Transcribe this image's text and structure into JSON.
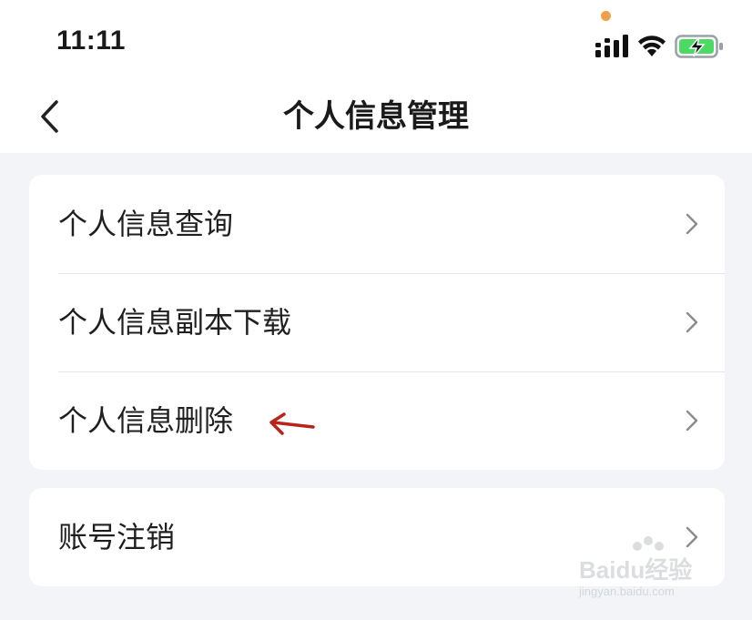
{
  "status_bar": {
    "time": "11:11"
  },
  "nav": {
    "title": "个人信息管理"
  },
  "groups": [
    {
      "items": [
        {
          "label": "个人信息查询"
        },
        {
          "label": "个人信息副本下载"
        },
        {
          "label": "个人信息删除"
        }
      ]
    },
    {
      "items": [
        {
          "label": "账号注销"
        }
      ]
    }
  ],
  "watermark": {
    "brand": "Baidu经验",
    "url": "jingyan.baidu.com"
  },
  "colors": {
    "annotation_arrow": "#b8241c",
    "battery_fill": "#4cd964",
    "recording_dot": "#f0a04b"
  },
  "icons": {
    "back": "chevron-left-icon",
    "row_action": "chevron-right-icon",
    "annotation": "arrow-left-icon"
  }
}
